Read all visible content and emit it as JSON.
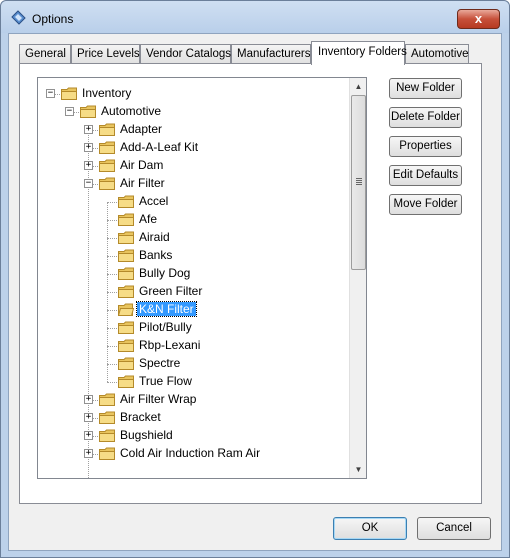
{
  "window": {
    "title": "Options",
    "close_glyph": "x"
  },
  "tabs": [
    {
      "label": "General"
    },
    {
      "label": "Price Levels"
    },
    {
      "label": "Vendor Catalogs"
    },
    {
      "label": "Manufacturers"
    },
    {
      "label": "Inventory Folders",
      "active": true
    },
    {
      "label": "Automotive"
    }
  ],
  "tree": {
    "nodes": [
      {
        "label": "Inventory",
        "level": 0,
        "expander": "-"
      },
      {
        "label": "Automotive",
        "level": 1,
        "expander": "-"
      },
      {
        "label": "Adapter",
        "level": 2,
        "expander": "+"
      },
      {
        "label": "Add-A-Leaf Kit",
        "level": 2,
        "expander": "+"
      },
      {
        "label": "Air Dam",
        "level": 2,
        "expander": "+"
      },
      {
        "label": "Air Filter",
        "level": 2,
        "expander": "-"
      },
      {
        "label": "Accel",
        "level": 3
      },
      {
        "label": "Afe",
        "level": 3
      },
      {
        "label": "Airaid",
        "level": 3
      },
      {
        "label": "Banks",
        "level": 3
      },
      {
        "label": "Bully Dog",
        "level": 3
      },
      {
        "label": "Green Filter",
        "level": 3
      },
      {
        "label": "K&N Filter",
        "level": 3,
        "selected": true
      },
      {
        "label": "Pilot/Bully",
        "level": 3
      },
      {
        "label": "Rbp-Lexani",
        "level": 3
      },
      {
        "label": "Spectre",
        "level": 3
      },
      {
        "label": "True Flow",
        "level": 3
      },
      {
        "label": "Air Filter Wrap",
        "level": 2,
        "expander": "+"
      },
      {
        "label": "Bracket",
        "level": 2,
        "expander": "+"
      },
      {
        "label": "Bugshield",
        "level": 2,
        "expander": "+"
      },
      {
        "label": "Cold Air Induction Ram Air",
        "level": 2,
        "expander": "+"
      }
    ]
  },
  "side_buttons": {
    "new_folder": "New Folder",
    "delete_folder": "Delete Folder",
    "properties": "Properties",
    "edit_defaults": "Edit Defaults",
    "move_folder": "Move Folder"
  },
  "footer": {
    "ok": "OK",
    "cancel": "Cancel"
  },
  "colors": {
    "selection": "#3399ff",
    "folder": "#f4d67a",
    "titlebar": "#bcd1ea"
  }
}
